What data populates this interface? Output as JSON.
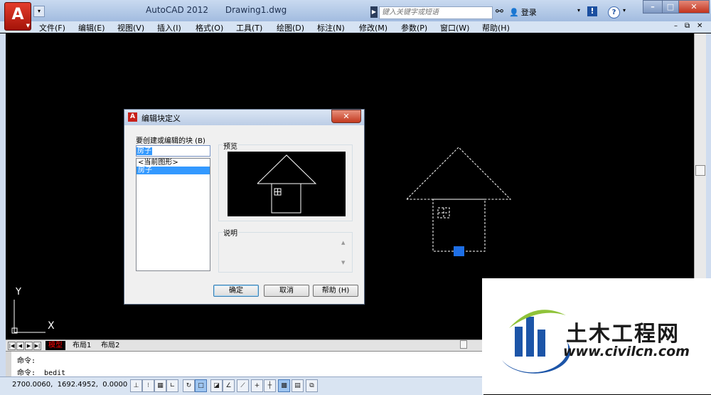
{
  "app": {
    "app_name": "AutoCAD 2012",
    "document": "Drawing1.dwg",
    "app_button_letter": "A"
  },
  "search": {
    "placeholder": "键入关键字或短语"
  },
  "infocenter": {
    "login": "登录"
  },
  "menu": [
    "文件(F)",
    "编辑(E)",
    "视图(V)",
    "插入(I)",
    "格式(O)",
    "工具(T)",
    "绘图(D)",
    "标注(N)",
    "修改(M)",
    "参数(P)",
    "窗口(W)",
    "帮助(H)"
  ],
  "ucs": {
    "y_label": "Y",
    "x_label": "X"
  },
  "layout_tabs": [
    "模型",
    "布局1",
    "布局2"
  ],
  "command": {
    "line1": "命令:",
    "line2": "命令: _bedit"
  },
  "status": {
    "coords": "2700.0060,  1692.4952,  0.0000"
  },
  "dialog": {
    "title": "编辑块定义",
    "close_label": "✕",
    "block_label": "要创建或编辑的块 (B)",
    "block_name": "房子",
    "list_items": [
      "<当前图形>",
      "房子"
    ],
    "selected_index": 1,
    "preview_label": "预览",
    "description_label": "说明",
    "ok_label": "确定",
    "cancel_label": "取消",
    "help_label": "帮助 (H)"
  },
  "watermark": {
    "brand": "土木工程网",
    "url": "www.civilcn.com"
  },
  "colors": {
    "drawing_bg": "#000000",
    "grip": "#1e6fe6",
    "selection": "#3399ff",
    "active_tab_text": "#ff0000"
  }
}
